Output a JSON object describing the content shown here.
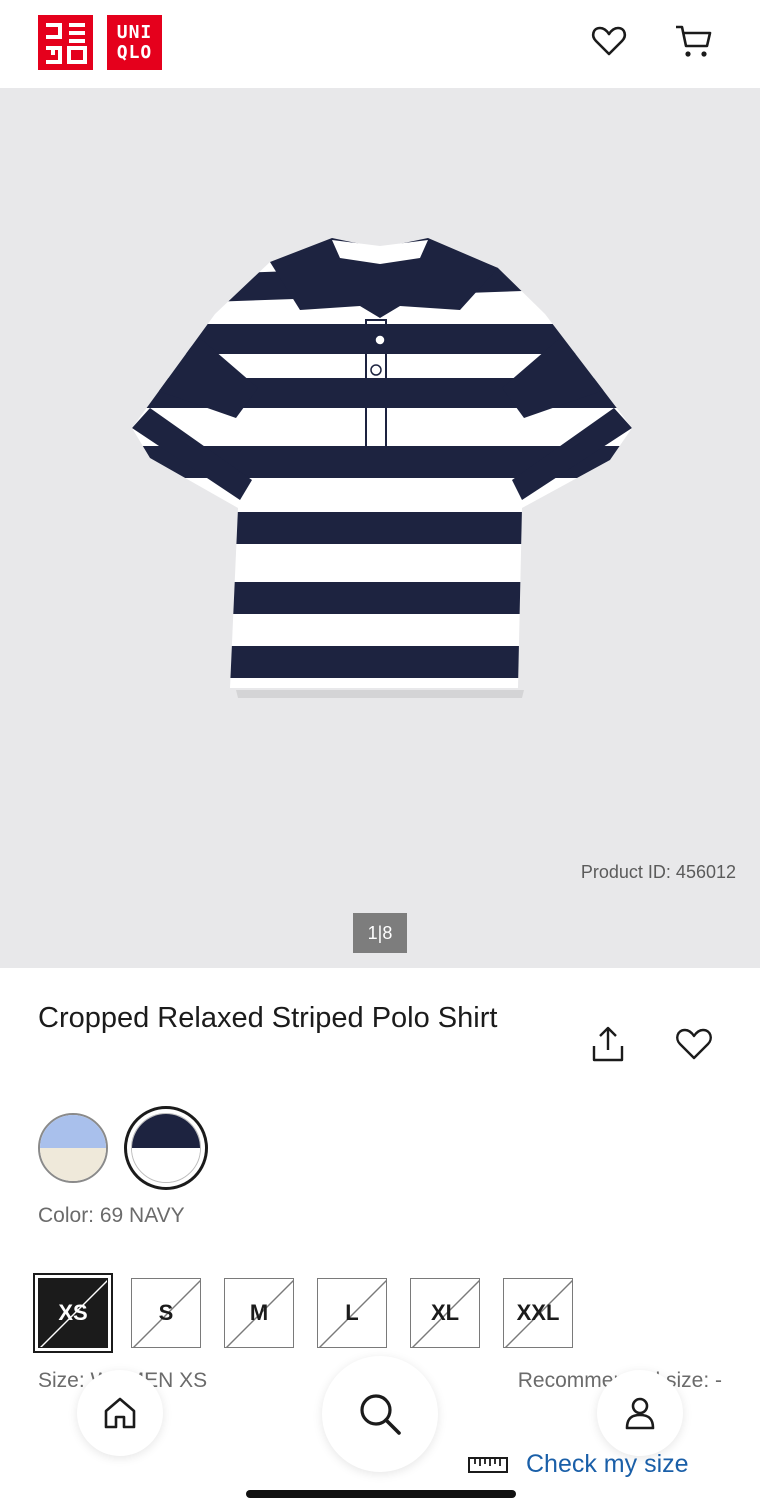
{
  "brand": {
    "name": "UNIQLO",
    "logo_text_en": [
      "UNI",
      "QLO"
    ],
    "accent_color": "#e5001c"
  },
  "header": {
    "icons": [
      "heart-icon",
      "cart-icon"
    ]
  },
  "hero": {
    "product_id_text": "Product ID: 456012",
    "pager_text": "1|8",
    "background_color": "#e8e8ea"
  },
  "product": {
    "title": "Cropped Relaxed Striped Polo Shirt",
    "icons": [
      "share-icon",
      "heart-icon"
    ]
  },
  "colors": {
    "label": "Color: 69 NAVY",
    "swatches": [
      {
        "top": "#a9c0ec",
        "bottom": "#efe9da",
        "selected": false
      },
      {
        "top": "#1d2340",
        "bottom": "#ffffff",
        "selected": true
      }
    ]
  },
  "sizes": {
    "options": [
      {
        "label": "XS",
        "selected": true,
        "unavailable": true
      },
      {
        "label": "S",
        "selected": false,
        "unavailable": true
      },
      {
        "label": "M",
        "selected": false,
        "unavailable": true
      },
      {
        "label": "L",
        "selected": false,
        "unavailable": true
      },
      {
        "label": "XL",
        "selected": false,
        "unavailable": true
      },
      {
        "label": "XXL",
        "selected": false,
        "unavailable": true
      }
    ],
    "size_label": "Size: WOMEN XS",
    "recommended_label": "Recommended size: -"
  },
  "bottom_nav": {
    "items": [
      "home-icon",
      "search-icon",
      "account-icon"
    ],
    "check_size_label": "Check my size",
    "check_size_icon": "ruler-icon",
    "link_color": "#1a5fa8"
  }
}
